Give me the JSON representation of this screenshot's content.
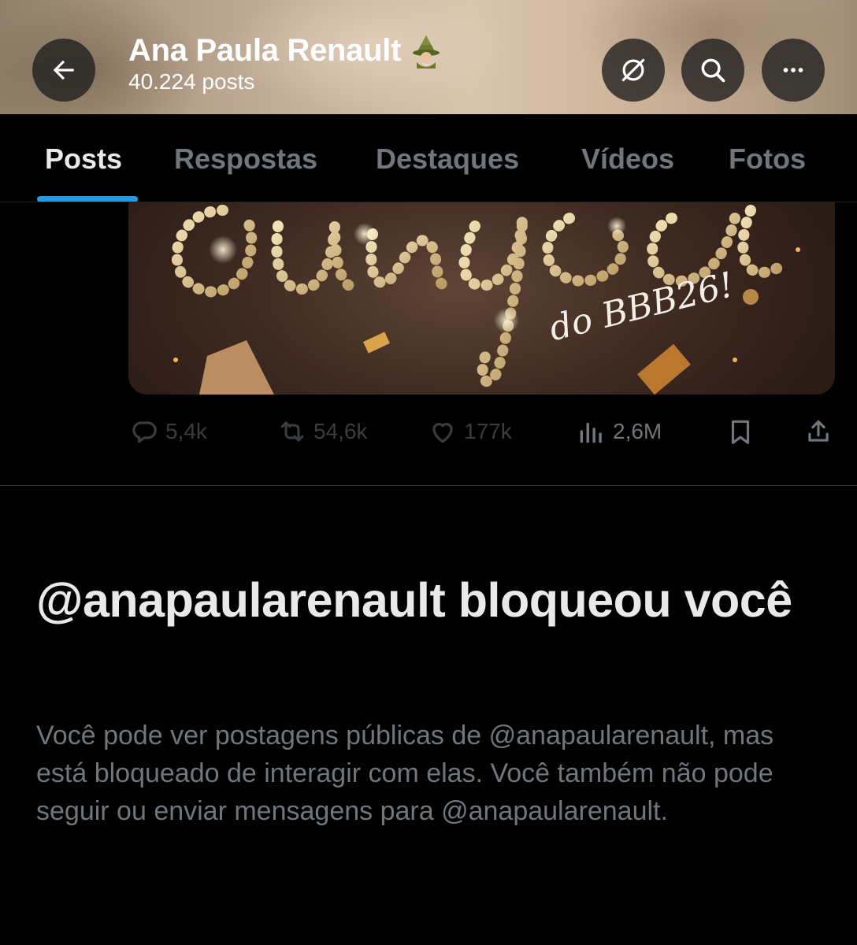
{
  "header": {
    "profile_name": "Ana Paula Renault",
    "post_count": "40.224 posts",
    "name_badge_icon": "mage-emoji-icon"
  },
  "tabs": [
    {
      "label": "Posts",
      "active": true
    },
    {
      "label": "Respostas",
      "active": false
    },
    {
      "label": "Destaques",
      "active": false
    },
    {
      "label": "Vídeos",
      "active": false
    },
    {
      "label": "Fotos",
      "active": false
    }
  ],
  "post": {
    "media_caption": "do BBB26!",
    "stats": {
      "replies": "5,4k",
      "reposts": "54,6k",
      "likes": "177k",
      "views": "2,6M"
    }
  },
  "blocked": {
    "title": "@anapaularenault bloqueou você",
    "body": "Você pode ver postagens públicas de @anapaularenault, mas está bloqueado de interagir com elas. Você também não pode seguir ou enviar mensagens para @anapaularenault."
  },
  "colors": {
    "accent": "#1d9bf0",
    "background": "#000000",
    "text_primary": "#e7e9ea",
    "text_secondary": "#71767b"
  }
}
